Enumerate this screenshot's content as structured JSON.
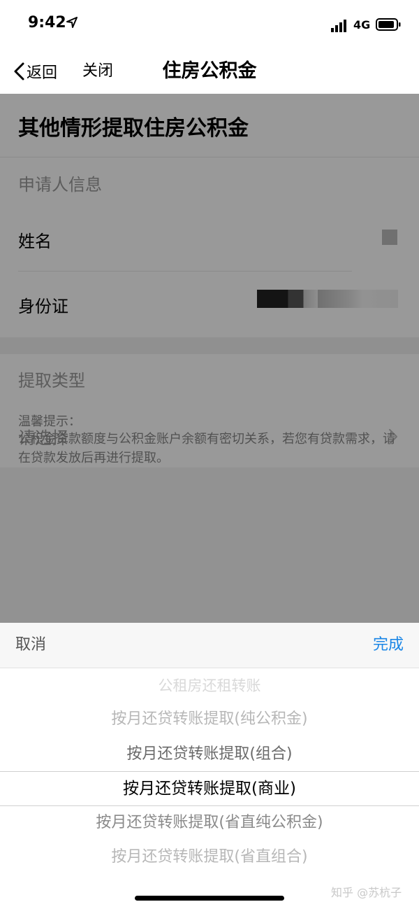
{
  "status": {
    "time": "9:42",
    "network": "4G"
  },
  "nav": {
    "back_label": "返回",
    "close_label": "关闭",
    "title": "住房公积金"
  },
  "form": {
    "title": "其他情形提取住房公积金",
    "applicant_section": "申请人信息",
    "name_label": "姓名",
    "id_label": "身份证",
    "type_section": "提取类型",
    "type_placeholder": "请选择"
  },
  "tips": {
    "title": "温馨提示：",
    "body": "公积金贷款额度与公积金账户余额有密切关系，若您有贷款需求，请在贷款发放后再进行提取。"
  },
  "picker": {
    "cancel_label": "取消",
    "done_label": "完成",
    "options": [
      "公租房还租转账",
      "按月还贷转账提取(纯公积金)",
      "按月还贷转账提取(组合)",
      "按月还贷转账提取(商业)",
      "按月还贷转账提取(省直纯公积金)",
      "按月还贷转账提取(省直组合)"
    ],
    "selected_option": "按月还贷转账提取(商业)"
  },
  "watermark": "知乎 @苏杭子",
  "colors": {
    "accent": "#1a86e6"
  }
}
